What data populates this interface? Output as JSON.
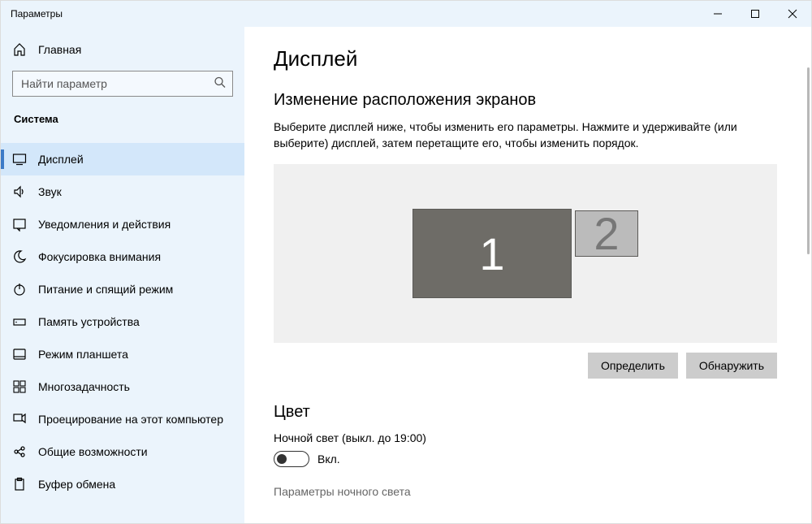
{
  "window": {
    "title": "Параметры"
  },
  "sidebar": {
    "home_label": "Главная",
    "search_placeholder": "Найти параметр",
    "category": "Система",
    "items": [
      {
        "label": "Дисплей",
        "icon": "display",
        "selected": true
      },
      {
        "label": "Звук",
        "icon": "sound",
        "selected": false
      },
      {
        "label": "Уведомления и действия",
        "icon": "notification",
        "selected": false
      },
      {
        "label": "Фокусировка внимания",
        "icon": "moon",
        "selected": false
      },
      {
        "label": "Питание и спящий режим",
        "icon": "power",
        "selected": false
      },
      {
        "label": "Память устройства",
        "icon": "storage",
        "selected": false
      },
      {
        "label": "Режим планшета",
        "icon": "tablet",
        "selected": false
      },
      {
        "label": "Многозадачность",
        "icon": "multitask",
        "selected": false
      },
      {
        "label": "Проецирование на этот компьютер",
        "icon": "project",
        "selected": false
      },
      {
        "label": "Общие возможности",
        "icon": "shared",
        "selected": false
      },
      {
        "label": "Буфер обмена",
        "icon": "clipboard",
        "selected": false
      }
    ]
  },
  "content": {
    "page_title": "Дисплей",
    "arrange": {
      "title": "Изменение расположения экранов",
      "desc": "Выберите дисплей ниже, чтобы изменить его параметры. Нажмите и удерживайте (или выберите) дисплей, затем перетащите его, чтобы изменить порядок.",
      "monitors": [
        {
          "label": "1",
          "primary": true
        },
        {
          "label": "2",
          "primary": false
        }
      ],
      "identify_label": "Определить",
      "detect_label": "Обнаружить"
    },
    "color": {
      "title": "Цвет",
      "night_light_label": "Ночной свет (выкл. до 19:00)",
      "toggle_state": "Вкл.",
      "night_light_settings": "Параметры ночного света"
    }
  }
}
